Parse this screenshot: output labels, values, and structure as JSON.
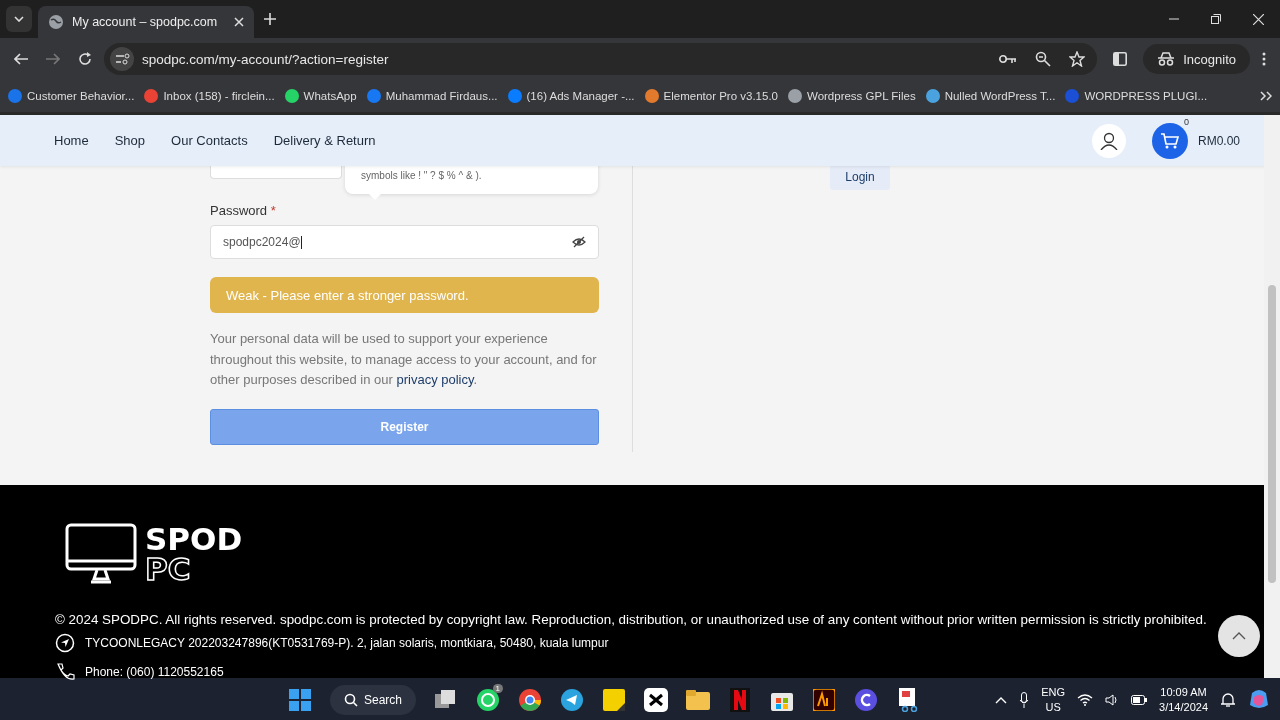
{
  "browser": {
    "tabs": [
      {
        "title": "My account – spodpc.com",
        "selected": true
      }
    ],
    "address": "spodpc.com/my-account/?action=register",
    "profile": "Incognito",
    "bookmarks": [
      {
        "label": "Customer Behavior...",
        "color": "#1a73e8"
      },
      {
        "label": "Inbox (158) - firclein...",
        "color": "#ea4335"
      },
      {
        "label": "WhatsApp",
        "color": "#25d366"
      },
      {
        "label": "Muhammad Firdaus...",
        "color": "#1877f2"
      },
      {
        "label": "(16) Ads Manager -...",
        "color": "#0a7cff"
      },
      {
        "label": "Elementor Pro v3.15.0",
        "color": "#e27a2e"
      },
      {
        "label": "Wordpress GPL Files",
        "color": "#9aa0a6"
      },
      {
        "label": "Nulled WordPress T...",
        "color": "#4aa3df"
      },
      {
        "label": "WORDPRESS PLUGI...",
        "color": "#1a4fd6"
      }
    ]
  },
  "site": {
    "nav": [
      {
        "label": "Home"
      },
      {
        "label": "Shop"
      },
      {
        "label": "Our Contacts"
      },
      {
        "label": "Delivery & Return"
      }
    ],
    "cart_count": "0",
    "cart_total": "RM0.00",
    "tooltip": "symbols like ! \" ? $ % ^ & ).",
    "password_label": "Password",
    "required_mark": "*",
    "password_value": "spodpc2024@",
    "strength": "Weak - Please enter a stronger password.",
    "privacy_before": "Your personal data will be used to support your experience throughout this website, to manage access to your account, and for other purposes described in our ",
    "privacy_link": "privacy policy",
    "privacy_after": ".",
    "register": "Register",
    "login": "Login"
  },
  "footer": {
    "logo_top": "SPOD",
    "logo_bottom": "PC",
    "copyright": "© 2024 SPODPC. All rights reserved. spodpc.com is protected by copyright law. Reproduction, distribution, or unauthorized use of any content without prior written permission is strictly prohibited.",
    "address": "TYCOONLEGACY 202203247896(KT0531769-P). 2, jalan solaris, montkiara, 50480, kuala lumpur",
    "phone": "Phone: (060) 1120552165"
  },
  "taskbar": {
    "search": "Search",
    "whatsapp_badge": "1",
    "lang_top": "ENG",
    "lang_bottom": "US",
    "time": "10:09 AM",
    "date": "3/14/2024"
  }
}
